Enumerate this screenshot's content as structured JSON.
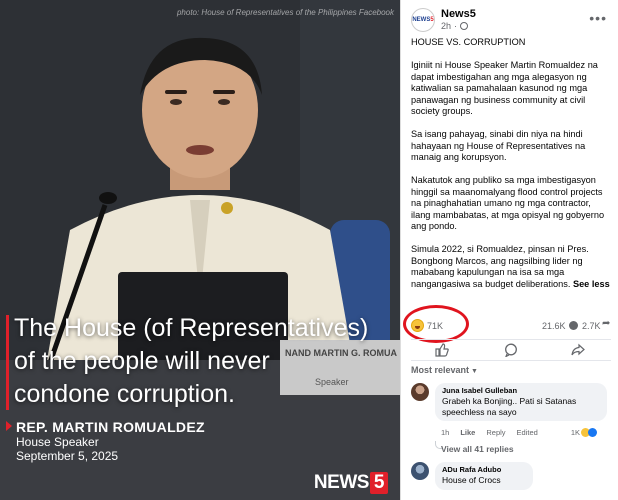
{
  "photo": {
    "credit": "photo: House of Representatives of the Philippines Facebook",
    "quote_lines": [
      "The House (of Representatives)",
      "of the people will never",
      "condone corruption."
    ],
    "speaker_name": "REP. MARTIN ROMUALDEZ",
    "speaker_role": "House Speaker",
    "speaker_date": "September 5, 2025",
    "nameplate_text": "NAND MARTIN G. ROMUA",
    "nameplate_sub": "Speaker",
    "brand_word": "NEWS",
    "brand_number": "5"
  },
  "post": {
    "avatar_text": "NEWS",
    "avatar_number": "5",
    "page_name": "News5",
    "time": "2h",
    "dot": "·",
    "more_icon": "more-horizontal-icon",
    "paragraphs": [
      "HOUSE VS. CORRUPTION",
      "Iginiit ni House Speaker Martin Romualdez na dapat imbestigahan ang mga alegasyon ng katiwalian sa pamahalaan kasunod ng mga panawagan ng business community at civil society groups.",
      "Sa isang pahayag, sinabi din niya na hindi hahayaan ng House of Representatives na manaig ang korupsyon.",
      "Nakatutok ang publiko sa mga imbestigasyon hinggil sa maanomalyang flood control projects na pinaghahatian umano ng mga contractor, ilang mambabatas, at mga opisyal ng gobyerno ang pondo.",
      "Simula 2022, si Romualdez, pinsan ni Pres. Bongbong Marcos, ang nagsilbing lider ng mababang kapulungan na isa sa mga nangangasiwa sa budget deliberations."
    ],
    "see_more": "See less",
    "reaction_count": "71K",
    "comments_count": "21.6K",
    "shares_count": "2.7K",
    "sort_label": "Most relevant",
    "highlight_color": "#e0141e"
  },
  "comments": [
    {
      "name": "Juna Isabel Gulleban",
      "text_lines": [
        "Grabeh ka Bonjing.. Pati si Satanas",
        "speechless na sayo"
      ],
      "time": "1h",
      "like": "Like",
      "reply": "Reply",
      "edited": "Edited",
      "reaction_count": "1K",
      "view_replies": "View all 41 replies"
    },
    {
      "name": "ADu Rafa Adubo",
      "text_lines": [
        "House of Crocs"
      ]
    }
  ],
  "colors": {
    "accent_red": "#e0202a",
    "fb_blue": "#1877f2",
    "muted": "#65676b"
  }
}
